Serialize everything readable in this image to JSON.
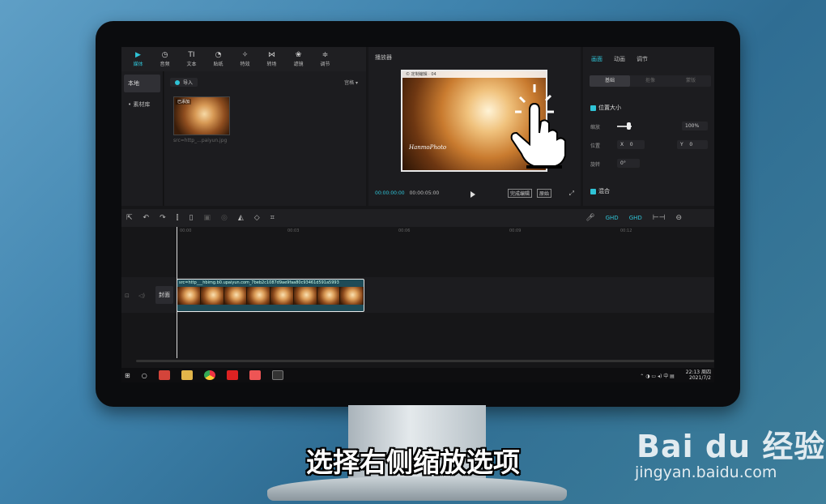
{
  "toolbar": {
    "items": [
      {
        "icon": "▶",
        "label": "媒体"
      },
      {
        "icon": "◷",
        "label": "音频"
      },
      {
        "icon": "TI",
        "label": "文本"
      },
      {
        "icon": "◔",
        "label": "贴纸"
      },
      {
        "icon": "✧",
        "label": "特效"
      },
      {
        "icon": "⋈",
        "label": "转场"
      },
      {
        "icon": "❀",
        "label": "滤镜"
      },
      {
        "icon": "≑",
        "label": "调节"
      }
    ]
  },
  "media": {
    "nav": [
      "本地",
      "• 素材库"
    ],
    "import_label": "导入",
    "sort_label": "宫格 ▾",
    "thumb_tag": "已添加",
    "thumb_name": "src=http_...paiyun.jpg"
  },
  "player": {
    "title": "播放器",
    "video_header": "© 定制编辑 · 04",
    "logo": "HanmoPhoto",
    "current_time": "00:00:00:00",
    "total_time": "00:00:05:00",
    "btn_fit": "完成编辑",
    "btn_ratio": "原始"
  },
  "inspector": {
    "tabs": [
      "画面",
      "动画",
      "调节"
    ],
    "subtabs": [
      "基础",
      "抠像",
      "蒙版"
    ],
    "section_position": "位置大小",
    "scale_label": "缩放",
    "scale_value": "100%",
    "position_label": "位置",
    "x_label": "X",
    "x_value": "0",
    "y_label": "Y",
    "y_value": "0",
    "rotate_label": "旋转",
    "rotate_value": "0°",
    "section_blend": "混合"
  },
  "timeline": {
    "ticks": [
      "00:00",
      "00:03",
      "00:06",
      "00:09",
      "00:12"
    ],
    "cover_label": "封面",
    "clip_src": "src=http___hbimg.b0.upaiyun.com_7beb2c1087d9ae9faa80c93461d591a5993",
    "toolbar_right": [
      "GHD",
      "GHD"
    ]
  },
  "taskbar": {
    "time": "22:13 周四",
    "date": "2021/7/2"
  },
  "caption": "选择右侧缩放选项",
  "watermark": {
    "logo": "Bai du 经验",
    "url": "jingyan.baidu.com"
  },
  "colors": {
    "accent": "#2fc3d6",
    "panel": "#1c1c1f",
    "clip": "#1e4b57"
  }
}
